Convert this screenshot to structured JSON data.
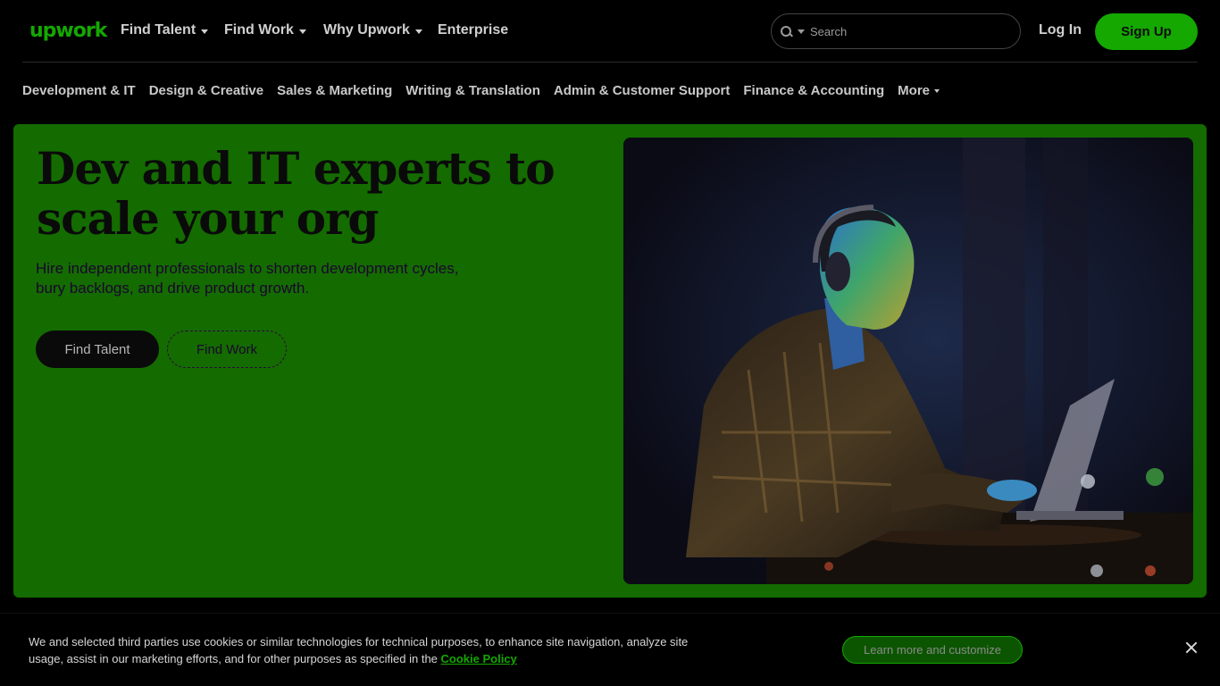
{
  "header": {
    "logo": "upwork",
    "nav": [
      {
        "label": "Find Talent",
        "has_dropdown": true
      },
      {
        "label": "Find Work",
        "has_dropdown": true
      },
      {
        "label": "Why Upwork",
        "has_dropdown": true
      },
      {
        "label": "Enterprise",
        "has_dropdown": false
      }
    ],
    "search": {
      "placeholder": "Search",
      "icon": "search-icon"
    },
    "login_label": "Log In",
    "signup_label": "Sign Up"
  },
  "categories": {
    "items": [
      "Development & IT",
      "Design & Creative",
      "Sales & Marketing",
      "Writing & Translation",
      "Admin & Customer Support",
      "Finance & Accounting"
    ],
    "more_label": "More"
  },
  "hero": {
    "headline": "Dev and IT experts to scale your org",
    "subtext": "Hire independent professionals to shorten development cycles, bury backlogs, and drive product growth.",
    "primary_button": "Find Talent",
    "secondary_button": "Find Work"
  },
  "cookie_banner": {
    "text": "We and selected third parties use cookies or similar technologies for technical purposes, to enhance site navigation, analyze site usage, assist in our marketing efforts, and for other purposes as specified in the",
    "link": "Cookie Policy",
    "button": "Learn more and customize"
  },
  "colors": {
    "brand": "#14a800",
    "hero_bg": "#146b00",
    "page_bg": "#000000"
  }
}
